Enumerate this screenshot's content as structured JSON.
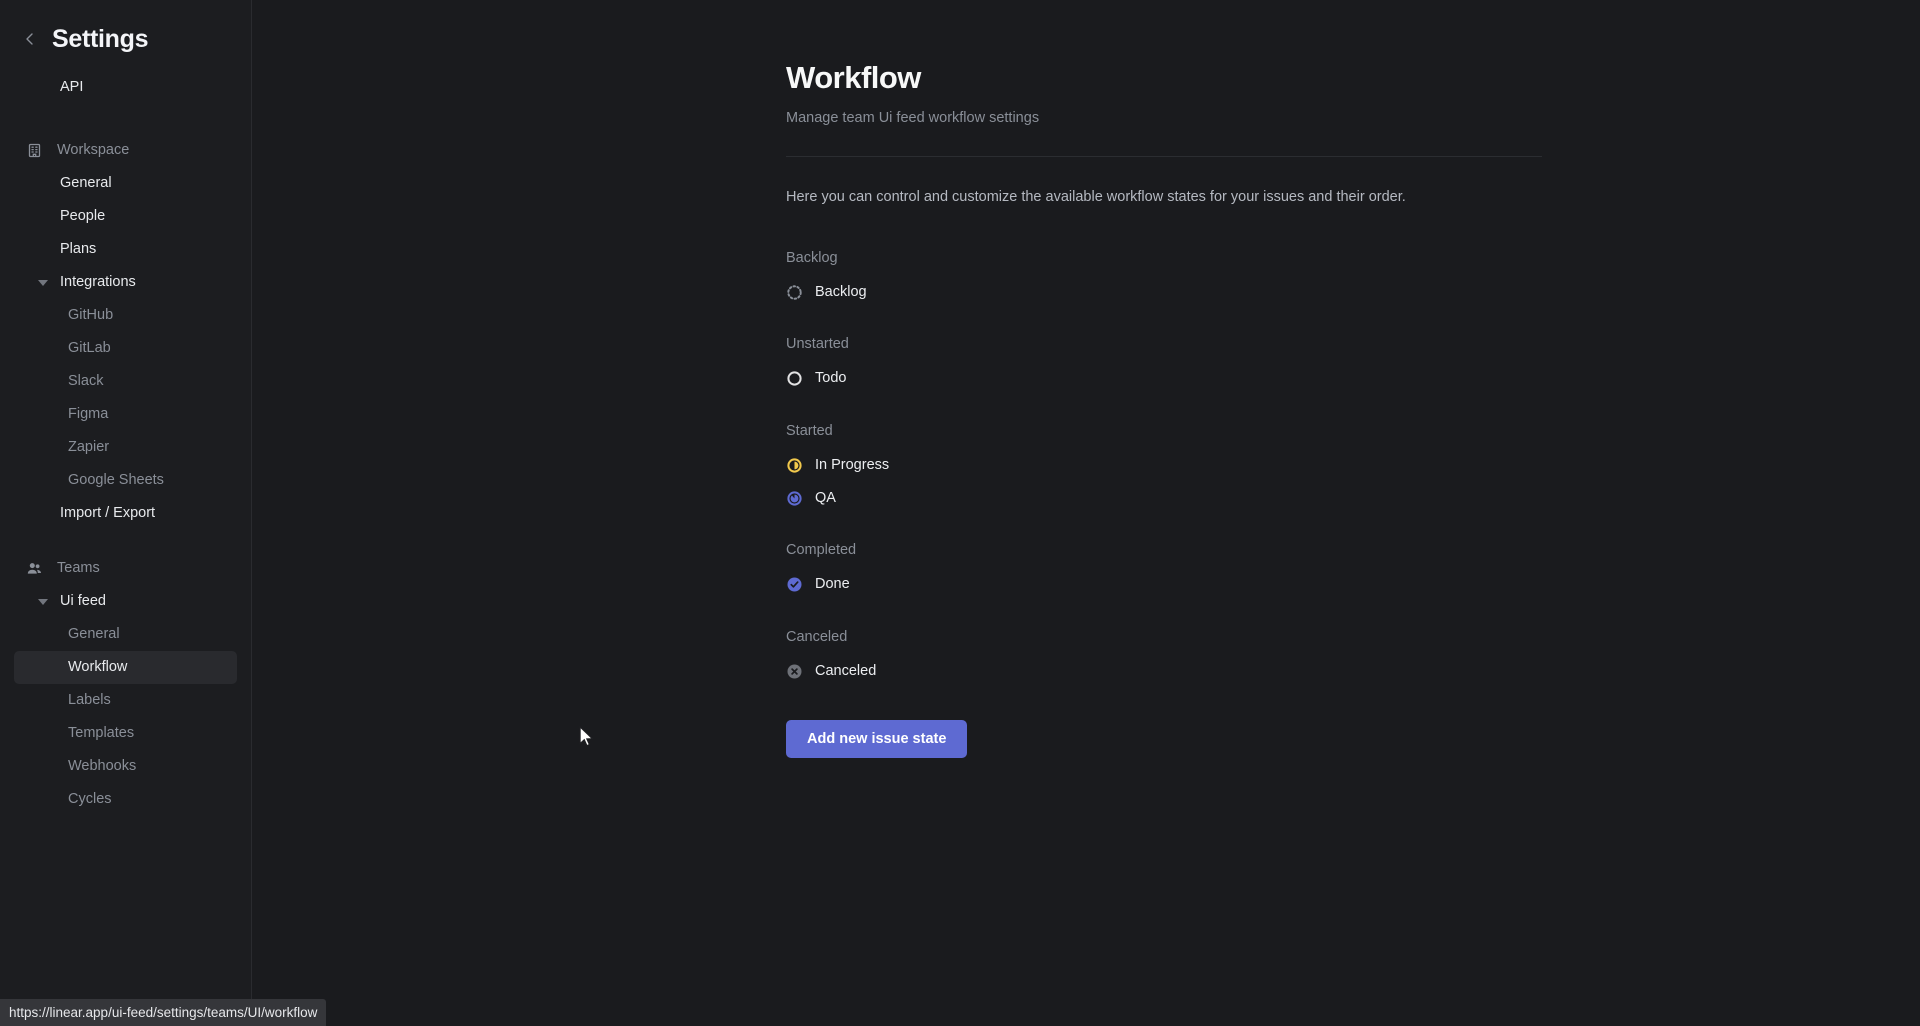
{
  "sidebar": {
    "back_icon": "chevron-left-icon",
    "title": "Settings",
    "api_item": {
      "label": "API"
    },
    "workspace": {
      "icon": "building-icon",
      "label": "Workspace",
      "items": [
        {
          "label": "General",
          "state": "bright"
        },
        {
          "label": "People",
          "state": "bright"
        },
        {
          "label": "Plans",
          "state": "bright"
        }
      ],
      "integrations": {
        "label": "Integrations",
        "caret": "caret-down-icon",
        "children": [
          {
            "label": "GitHub"
          },
          {
            "label": "GitLab"
          },
          {
            "label": "Slack"
          },
          {
            "label": "Figma"
          },
          {
            "label": "Zapier"
          },
          {
            "label": "Google Sheets"
          }
        ]
      },
      "import_export": {
        "label": "Import / Export"
      }
    },
    "teams": {
      "icon": "users-icon",
      "label": "Teams",
      "team": {
        "label": "Ui feed",
        "caret": "caret-down-icon",
        "items": [
          {
            "label": "General",
            "selected": false
          },
          {
            "label": "Workflow",
            "selected": true
          },
          {
            "label": "Labels",
            "selected": false
          },
          {
            "label": "Templates",
            "selected": false
          },
          {
            "label": "Webhooks",
            "selected": false
          },
          {
            "label": "Cycles",
            "selected": false
          }
        ]
      }
    }
  },
  "main": {
    "title": "Workflow",
    "subtitle": "Manage team Ui feed workflow settings",
    "intro": "Here you can control and customize the available workflow states for your issues and their order.",
    "groups": [
      {
        "title": "Backlog",
        "states": [
          {
            "name": "Backlog",
            "icon": "backlog-dotted-circle-icon",
            "color": "#8a8f98"
          }
        ]
      },
      {
        "title": "Unstarted",
        "states": [
          {
            "name": "Todo",
            "icon": "todo-empty-circle-icon",
            "color": "#e2e2e3"
          }
        ]
      },
      {
        "title": "Started",
        "states": [
          {
            "name": "In Progress",
            "icon": "in-progress-half-circle-icon",
            "color": "#f2c94c"
          },
          {
            "name": "QA",
            "icon": "qa-partial-circle-icon",
            "color": "#5e6ad2"
          }
        ]
      },
      {
        "title": "Completed",
        "states": [
          {
            "name": "Done",
            "icon": "done-check-circle-icon",
            "color": "#5e6ad2"
          }
        ]
      },
      {
        "title": "Canceled",
        "states": [
          {
            "name": "Canceled",
            "icon": "canceled-x-circle-icon",
            "color": "#6e7178"
          }
        ]
      }
    ],
    "add_button": {
      "label": "Add new issue state",
      "color": "#5e6ad2"
    }
  },
  "status_bar": {
    "url": "https://linear.app/ui-feed/settings/teams/UI/workflow"
  }
}
